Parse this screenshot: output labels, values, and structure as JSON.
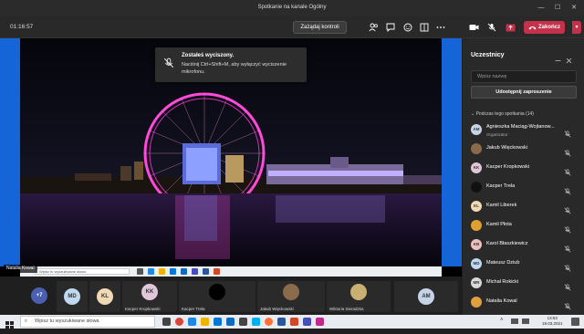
{
  "window": {
    "title": "Spotkanie na kanale Ogólny"
  },
  "toolbar": {
    "timer": "01:16:57",
    "raise_label": "Zażądaj kontroli",
    "leave_label": "Zakończ"
  },
  "toast": {
    "title": "Zostałeś wyciszony.",
    "body": "Naciśnij Ctrl+Shift+M, aby wyłączyć wyciszenie mikrofonu."
  },
  "stage": {
    "speaker": "Natalia Kowal",
    "mini_search": "Wpisz tu wyszukiwane słowo"
  },
  "panel": {
    "title": "Uczestnicy",
    "search_placeholder": "Wpisz nazwę",
    "share_label": "Udostępnij zaproszenie",
    "section_label": "Podczas tego spotkania (14)",
    "participants": [
      {
        "name": "Agnieszka Maciąg-Wojtanow...",
        "sub": "Organizator",
        "initials": "AM",
        "color": "#c7d4e8"
      },
      {
        "name": "Jakub Więckowski",
        "sub": "",
        "initials": "",
        "color": "#8a6a4a"
      },
      {
        "name": "Kacper Kropkowski",
        "sub": "",
        "initials": "KK",
        "color": "#e0c6d8"
      },
      {
        "name": "Kacper Trela",
        "sub": "",
        "initials": "",
        "color": "#111111"
      },
      {
        "name": "Kamil Liberek",
        "sub": "",
        "initials": "KL",
        "color": "#f0d9b5"
      },
      {
        "name": "Kamil Płota",
        "sub": "",
        "initials": "",
        "color": "#e0a030"
      },
      {
        "name": "Karol Błaszkiewicz",
        "sub": "",
        "initials": "KB",
        "color": "#f0c0c0"
      },
      {
        "name": "Mateusz Dziub",
        "sub": "",
        "initials": "MD",
        "color": "#c0d8f0"
      },
      {
        "name": "Michał Rokicki",
        "sub": "",
        "initials": "MR",
        "color": "#d8d8d8"
      },
      {
        "name": "Natalia Kowal",
        "sub": "",
        "initials": "",
        "color": "#e0a040"
      }
    ]
  },
  "gallery": {
    "more": "+7",
    "tiles": [
      {
        "initials": "MD",
        "name": "",
        "color": "#c0d8f0"
      },
      {
        "initials": "KL",
        "name": "",
        "color": "#f0d9b5"
      },
      {
        "initials": "KK",
        "name": "Kacper Kropkowski",
        "color": "#e0c6d8"
      },
      {
        "initials": "",
        "name": "Kacper Trela",
        "color": "#000000"
      },
      {
        "initials": "",
        "name": "Jakub Więckowski",
        "color": "#8a6a4a"
      },
      {
        "initials": "",
        "name": "Wiktoria Sieradzka",
        "color": "#c8b070"
      },
      {
        "initials": "AM",
        "name": "",
        "color": "#c7d4e8"
      }
    ]
  },
  "taskbar": {
    "search_label": "Wpisz tu wyszukiwane słowa",
    "time": "13:53",
    "date": "19.03.2021"
  }
}
